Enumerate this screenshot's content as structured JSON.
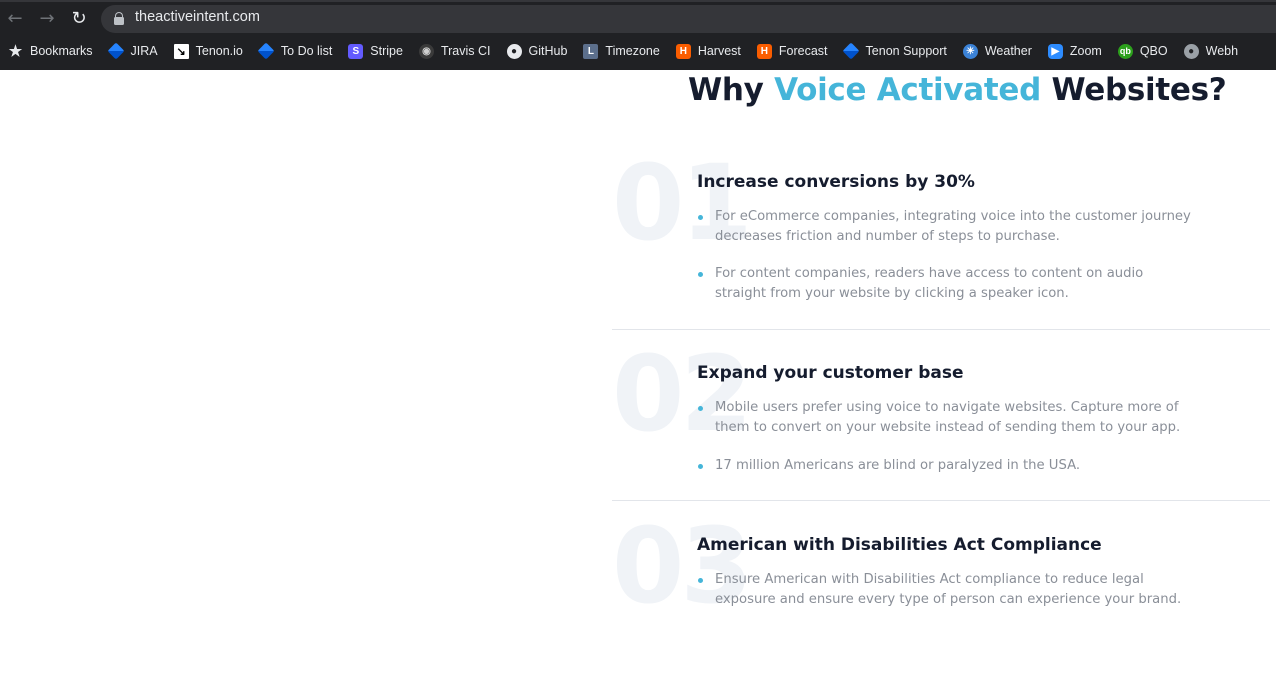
{
  "browser": {
    "url": "theactiveintent.com",
    "bookmarks": [
      {
        "label": "Bookmarks",
        "icon": "star-icon"
      },
      {
        "label": "JIRA",
        "icon": "jira-icon"
      },
      {
        "label": "Tenon.io",
        "icon": "tenon-icon"
      },
      {
        "label": "To Do list",
        "icon": "jira-icon"
      },
      {
        "label": "Stripe",
        "icon": "stripe-icon"
      },
      {
        "label": "Travis CI",
        "icon": "travis-icon"
      },
      {
        "label": "GitHub",
        "icon": "github-icon"
      },
      {
        "label": "Timezone",
        "icon": "timezone-icon"
      },
      {
        "label": "Harvest",
        "icon": "harvest-icon"
      },
      {
        "label": "Forecast",
        "icon": "harvest-icon"
      },
      {
        "label": "Tenon Support",
        "icon": "jira-icon"
      },
      {
        "label": "Weather",
        "icon": "weather-icon"
      },
      {
        "label": "Zoom",
        "icon": "zoom-icon"
      },
      {
        "label": "QBO",
        "icon": "qbo-icon"
      },
      {
        "label": "Webh",
        "icon": "webh-icon"
      }
    ]
  },
  "content": {
    "heading": {
      "prefix": "Why ",
      "accent": "Voice Activated",
      "suffix": " Websites?",
      "accent_color": "#45b5d9"
    },
    "sections": [
      {
        "number": "01",
        "title": "Increase conversions by 30%",
        "bullets": [
          "For eCommerce companies, integrating voice into the customer journey decreases friction and number of steps to purchase.",
          "For content companies, readers have access to content on audio straight from your website by clicking a speaker icon."
        ]
      },
      {
        "number": "02",
        "title": "Expand your customer base",
        "bullets": [
          "Mobile users prefer using voice to navigate websites. Capture more of them to convert on your website instead of sending them to your app.",
          "17 million Americans are blind or paralyzed in the USA."
        ]
      },
      {
        "number": "03",
        "title": "American with Disabilities Act Compliance",
        "bullets": [
          "Ensure American with Disabilities Act compliance to reduce legal exposure and ensure every type of person can experience your brand."
        ]
      }
    ]
  }
}
